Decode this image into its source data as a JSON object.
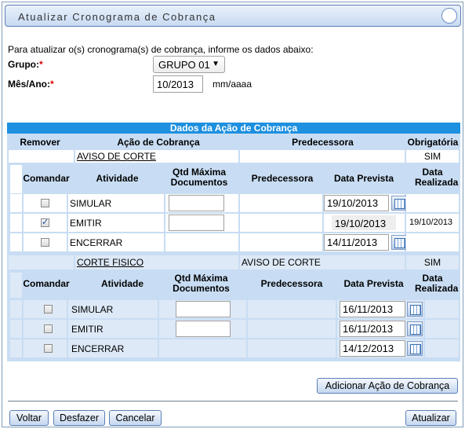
{
  "title": "Atualizar Cronograma de Cobrança",
  "intro": "Para atualizar o(s) cronograma(s) de cobrança, informe os dados abaixo:",
  "form": {
    "grupo_label": "Grupo:",
    "grupo_value": "GRUPO 01",
    "mesano_label": "Mês/Ano:",
    "mesano_value": "10/2013",
    "mesano_hint": "mm/aaaa",
    "required_mark": "*"
  },
  "section": {
    "title": "Dados da Ação de Cobrança",
    "headers": {
      "remover": "Remover",
      "acao": "Ação de Cobrança",
      "predecessora": "Predecessora",
      "obrigatoria": "Obrigatória"
    },
    "sub_headers": {
      "comandar": "Comandar",
      "atividade": "Atividade",
      "qtd": "Qtd Máxima Documentos",
      "predecessora": "Predecessora",
      "data_prevista": "Data Prevista",
      "data_realizada": "Data Realizada"
    },
    "acoes": [
      {
        "nome": "AVISO DE CORTE",
        "predecessora": "",
        "obrigatoria": "SIM",
        "atividades": [
          {
            "nome": "SIMULAR",
            "checked": false,
            "qtd": "",
            "data_prevista": "19/10/2013",
            "data_realizada": ""
          },
          {
            "nome": "EMITIR",
            "checked": true,
            "qtd": "",
            "data_prevista": "19/10/2013",
            "data_realizada": "19/10/2013"
          },
          {
            "nome": "ENCERRAR",
            "checked": false,
            "qtd": "",
            "data_prevista": "14/11/2013",
            "data_realizada": ""
          }
        ]
      },
      {
        "nome": "CORTE FISICO",
        "predecessora": "AVISO DE CORTE",
        "obrigatoria": "SIM",
        "atividades": [
          {
            "nome": "SIMULAR",
            "checked": false,
            "qtd": "",
            "data_prevista": "16/11/2013",
            "data_realizada": ""
          },
          {
            "nome": "EMITIR",
            "checked": false,
            "qtd": "",
            "data_prevista": "16/11/2013",
            "data_realizada": ""
          },
          {
            "nome": "ENCERRAR",
            "checked": false,
            "qtd": "",
            "data_prevista": "14/12/2013",
            "data_realizada": ""
          }
        ]
      }
    ]
  },
  "buttons": {
    "adicionar": "Adicionar Ação de Cobrança",
    "voltar": "Voltar",
    "desfazer": "Desfazer",
    "cancelar": "Cancelar",
    "atualizar": "Atualizar"
  }
}
